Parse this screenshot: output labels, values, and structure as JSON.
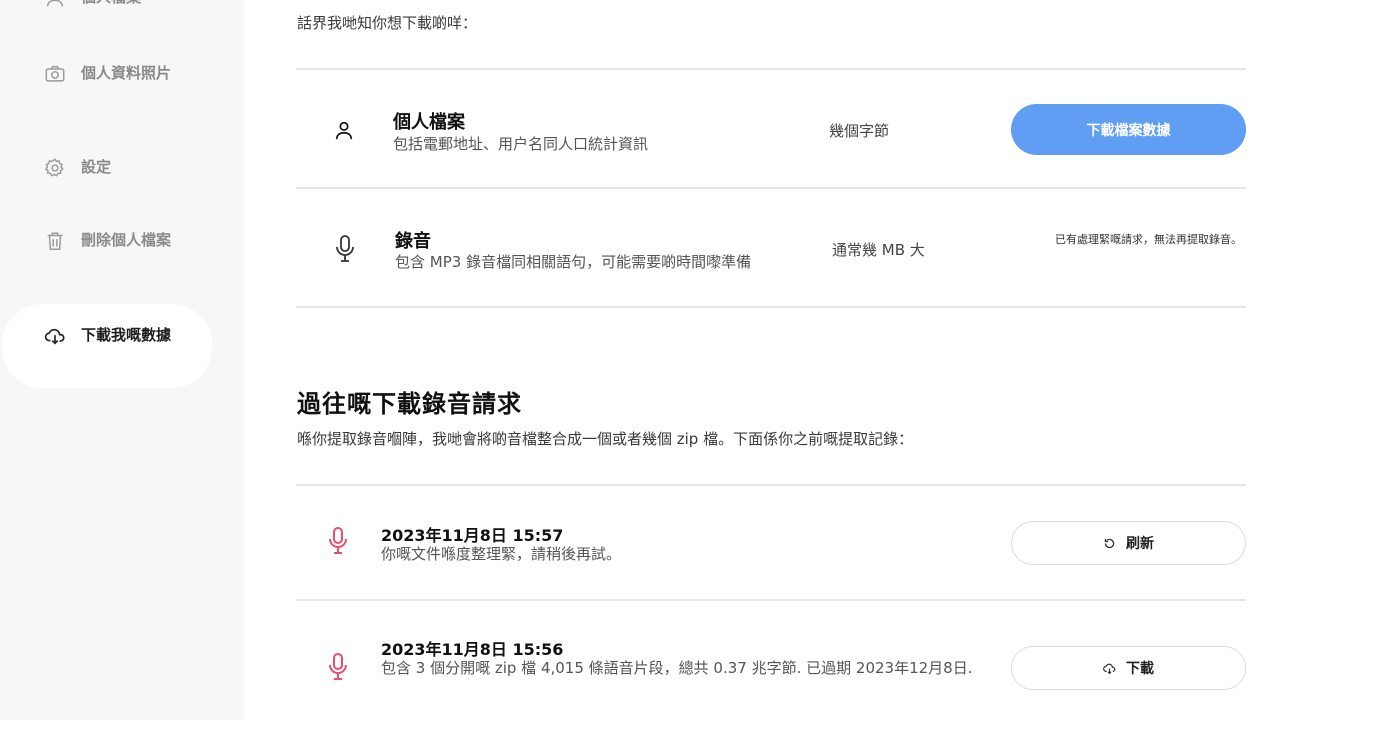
{
  "sidebar": {
    "items": [
      {
        "label": "個人檔案",
        "icon": "user-icon"
      },
      {
        "label": "個人資料照片",
        "icon": "camera-icon"
      },
      {
        "label": "設定",
        "icon": "gear-icon"
      },
      {
        "label": "刪除個人檔案",
        "icon": "trash-icon"
      },
      {
        "label": "下載我嘅數據",
        "icon": "cloud-download-icon",
        "active": true
      }
    ]
  },
  "main": {
    "intro": "話界我哋知你想下載啲咩：",
    "profile_row": {
      "title": "個人檔案",
      "subtitle": "包括電郵地址、用户名同人口統計資訊",
      "size": "幾個字節",
      "button": "下載檔案數據"
    },
    "recording_row": {
      "title": "錄音",
      "subtitle": "包含 MP3 錄音檔同相關語句，可能需要啲時間嚟準備",
      "size": "通常幾 MB 大",
      "note": "已有處理緊嘅請求，無法再提取錄音。"
    },
    "history": {
      "title": "過往嘅下載錄音請求",
      "description": "喺你提取錄音嗰陣，我哋會將啲音檔整合成一個或者幾個 zip 檔。下面係你之前嘅提取記錄：",
      "requests": [
        {
          "date": "2023年11月8日 15:57",
          "description": "你嘅文件喺度整理緊，請稍後再試。",
          "button": "刷新",
          "button_icon": "refresh-icon"
        },
        {
          "date": "2023年11月8日 15:56",
          "description": "包含 3 個分開嘅 zip 檔 4,015 條語音片段，總共 0.37 兆字節. 已過期 2023年12月8日.",
          "button": "下載",
          "button_icon": "cloud-download-icon"
        }
      ]
    }
  },
  "colors": {
    "accent": "#5f9ef2",
    "mic_red": "#e9506a",
    "sidebar_bg": "#f7f7f5"
  }
}
